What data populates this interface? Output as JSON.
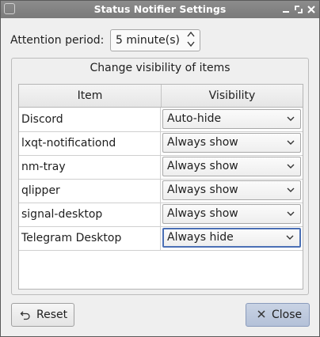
{
  "window": {
    "title": "Status Notifier Settings",
    "controls": [
      "minimize-icon",
      "maximize-icon",
      "close-icon"
    ]
  },
  "attention": {
    "label": "Attention period:",
    "value": "5 minute(s)"
  },
  "group": {
    "title": "Change visibility of items",
    "columns": {
      "item": "Item",
      "visibility": "Visibility"
    },
    "rows": [
      {
        "item": "Discord",
        "visibility": "Auto-hide"
      },
      {
        "item": "lxqt-notificationd",
        "visibility": "Always show"
      },
      {
        "item": "nm-tray",
        "visibility": "Always show"
      },
      {
        "item": "qlipper",
        "visibility": "Always show"
      },
      {
        "item": "signal-desktop",
        "visibility": "Always show"
      },
      {
        "item": "Telegram Desktop",
        "visibility": "Always hide"
      }
    ]
  },
  "buttons": {
    "reset": "Reset",
    "close": "Close"
  },
  "colors": {
    "titlebar": "#7a7a7a",
    "focus_accent": "#4a6fb5",
    "close_button": "#b4c1d8"
  }
}
